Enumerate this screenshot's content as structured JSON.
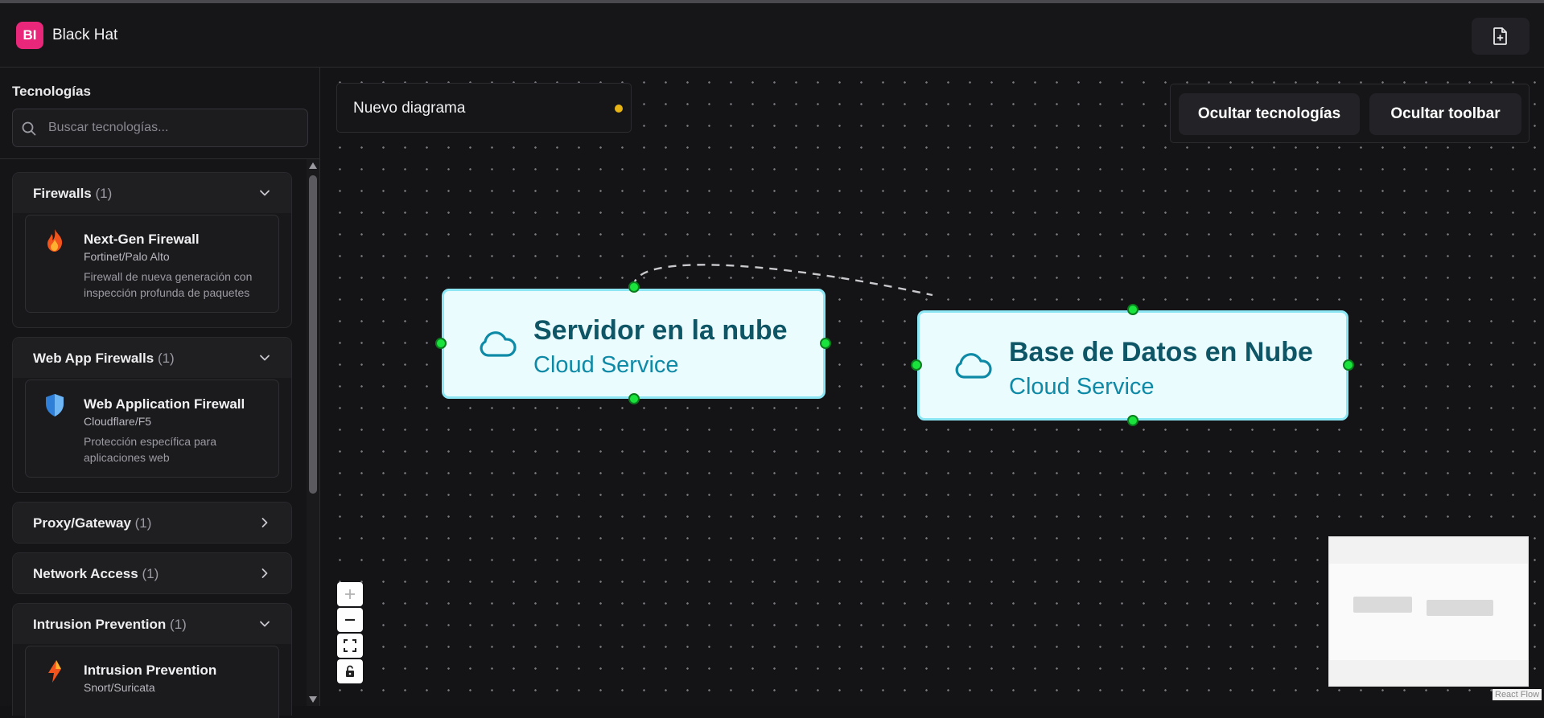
{
  "app": {
    "logo_text": "BI",
    "name": "Black Hat"
  },
  "header": {
    "new_file_icon": "file-plus-icon"
  },
  "sidebar": {
    "title": "Tecnologías",
    "search_placeholder": "Buscar tecnologías...",
    "categories": [
      {
        "label": "Firewalls",
        "count": "(1)",
        "expanded": true,
        "items": [
          {
            "name": "Next-Gen Firewall",
            "vendor": "Fortinet/Palo Alto",
            "description": "Firewall de nueva generación con inspección profunda de paquetes",
            "icon": "fire-icon"
          }
        ]
      },
      {
        "label": "Web App Firewalls",
        "count": "(1)",
        "expanded": true,
        "items": [
          {
            "name": "Web Application Firewall",
            "vendor": "Cloudflare/F5",
            "description": "Protección específica para aplicaciones web",
            "icon": "shield-icon"
          }
        ]
      },
      {
        "label": "Proxy/Gateway",
        "count": "(1)",
        "expanded": false,
        "items": []
      },
      {
        "label": "Network Access",
        "count": "(1)",
        "expanded": false,
        "items": []
      },
      {
        "label": "Intrusion Prevention",
        "count": "(1)",
        "expanded": true,
        "items": [
          {
            "name": "Intrusion Prevention",
            "vendor": "Snort/Suricata",
            "description": "",
            "icon": "lightning-icon"
          }
        ]
      }
    ]
  },
  "canvas": {
    "diagram_name": "Nuevo diagrama",
    "unsaved_indicator_color": "#e7b416",
    "toolbar": {
      "hide_technologies": "Ocultar tecnologías",
      "hide_toolbar": "Ocultar toolbar"
    },
    "nodes": [
      {
        "title": "Servidor en la nube",
        "subtitle": "Cloud Service",
        "icon": "cloud-icon"
      },
      {
        "title": "Base de Datos en Nube",
        "subtitle": "Cloud Service",
        "icon": "cloud-icon"
      }
    ],
    "edge_style": "dashed",
    "controls": [
      "zoom-in",
      "zoom-out",
      "fit-view",
      "lock"
    ],
    "attribution": "React Flow"
  },
  "colors": {
    "accent": "#e8267a",
    "node_bg": "#ebfcff",
    "node_border": "#8ce6f4",
    "node_title": "#0e5566",
    "node_subtitle": "#0e8aa6",
    "handle": "#19e33c"
  }
}
